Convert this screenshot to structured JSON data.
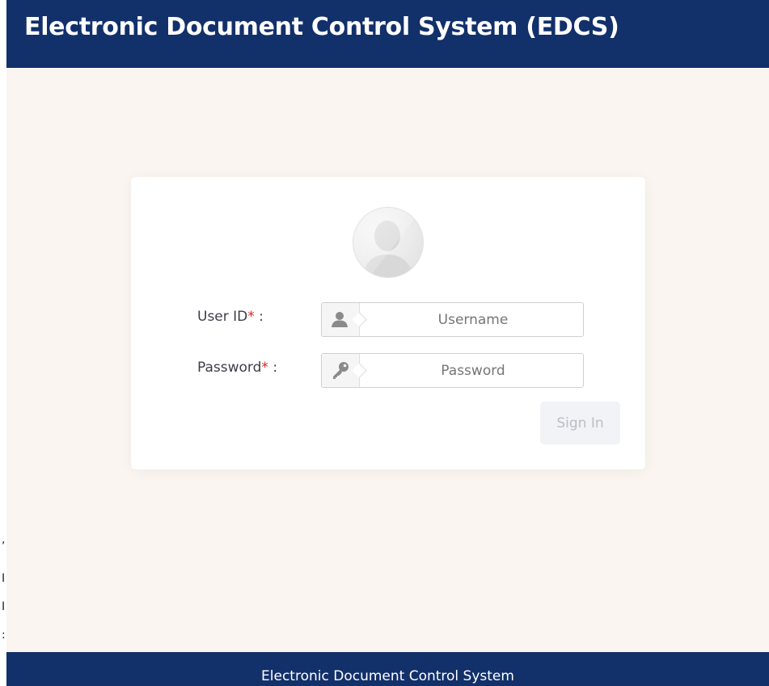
{
  "header": {
    "title": "Electronic Document Control System (EDCS)"
  },
  "login": {
    "user_id_label": "User ID",
    "password_label": "Password",
    "required_mark": "*",
    "separator": ":",
    "username_placeholder": "Username",
    "password_placeholder": "Password",
    "sign_in_label": "Sign In",
    "avatar_icon": "user-avatar-icon",
    "username_icon": "user-icon",
    "password_icon": "key-icon"
  },
  "footer": {
    "text": "Electronic Document Control System"
  },
  "colors": {
    "header_bg": "#12306a",
    "page_bg": "#faf5f0",
    "required": "#e02424",
    "button_bg": "#f1f3f6",
    "button_text": "#b8bec8"
  }
}
